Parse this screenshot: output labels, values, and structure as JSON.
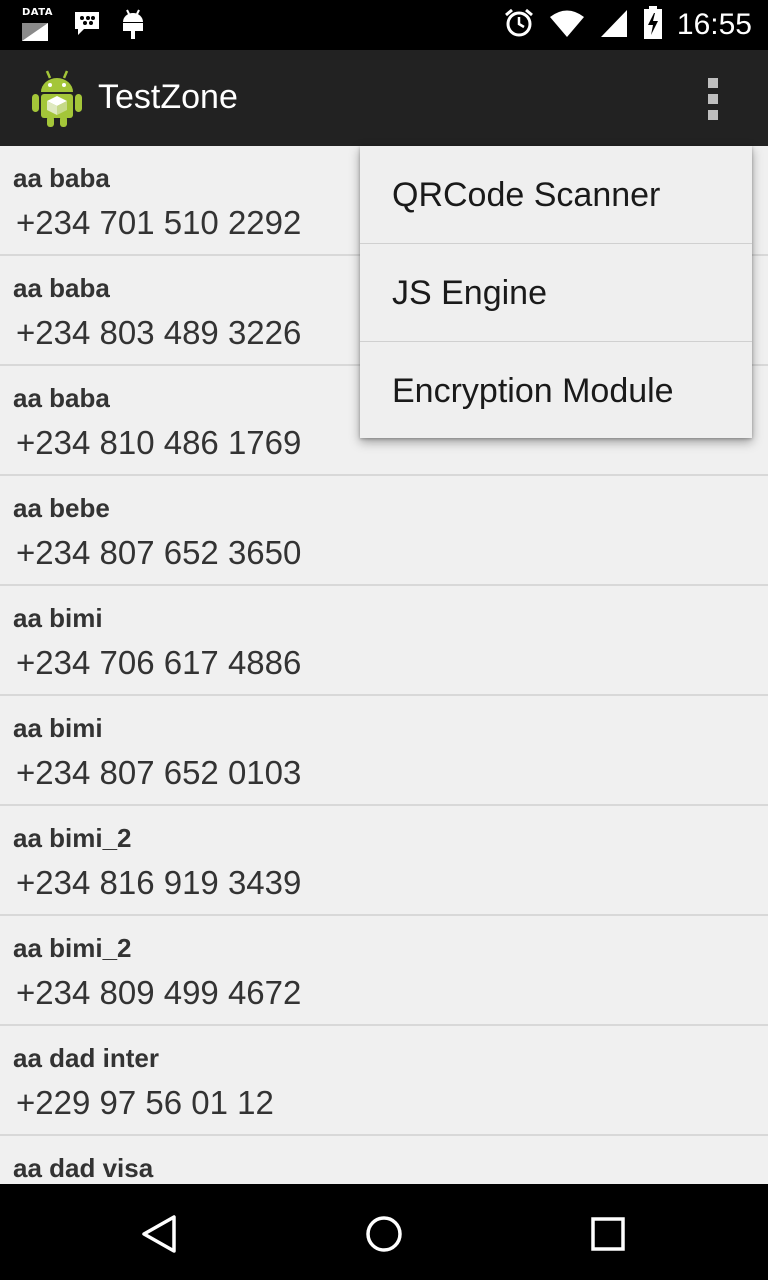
{
  "status_bar": {
    "time": "16:55",
    "data_label": "DATA",
    "icons": [
      "data-signal-icon",
      "blackberry-messenger-icon",
      "android-notification-icon",
      "alarm-icon",
      "wifi-icon",
      "cell-signal-icon",
      "battery-charging-icon"
    ]
  },
  "action_bar": {
    "title": "TestZone",
    "app_icon": "android-app-icon",
    "overflow_icon": "overflow-menu-icon"
  },
  "contacts": [
    {
      "name": "aa baba",
      "phone": "+234 701 510 2292"
    },
    {
      "name": "aa baba",
      "phone": "+234 803 489 3226"
    },
    {
      "name": "aa baba",
      "phone": "+234 810 486 1769"
    },
    {
      "name": "aa bebe",
      "phone": "+234 807 652 3650"
    },
    {
      "name": "aa bimi",
      "phone": "+234 706 617 4886"
    },
    {
      "name": "aa bimi",
      "phone": "+234 807 652 0103"
    },
    {
      "name": "aa bimi_2",
      "phone": "+234 816 919 3439"
    },
    {
      "name": "aa bimi_2",
      "phone": "+234 809 499 4672"
    },
    {
      "name": "aa dad inter",
      "phone": "+229 97 56 01 12"
    },
    {
      "name": "aa dad visa",
      "phone": ""
    }
  ],
  "overflow_menu": {
    "items": [
      {
        "label": "QRCode Scanner"
      },
      {
        "label": "JS Engine"
      },
      {
        "label": "Encryption Module"
      }
    ]
  },
  "nav_bar": {
    "icons": [
      "back-icon",
      "home-icon",
      "recents-icon"
    ]
  },
  "colors": {
    "action_bar": "#222222",
    "list_bg": "#f0f0f0",
    "menu_bg": "#efefef",
    "android_green": "#a4c639"
  }
}
